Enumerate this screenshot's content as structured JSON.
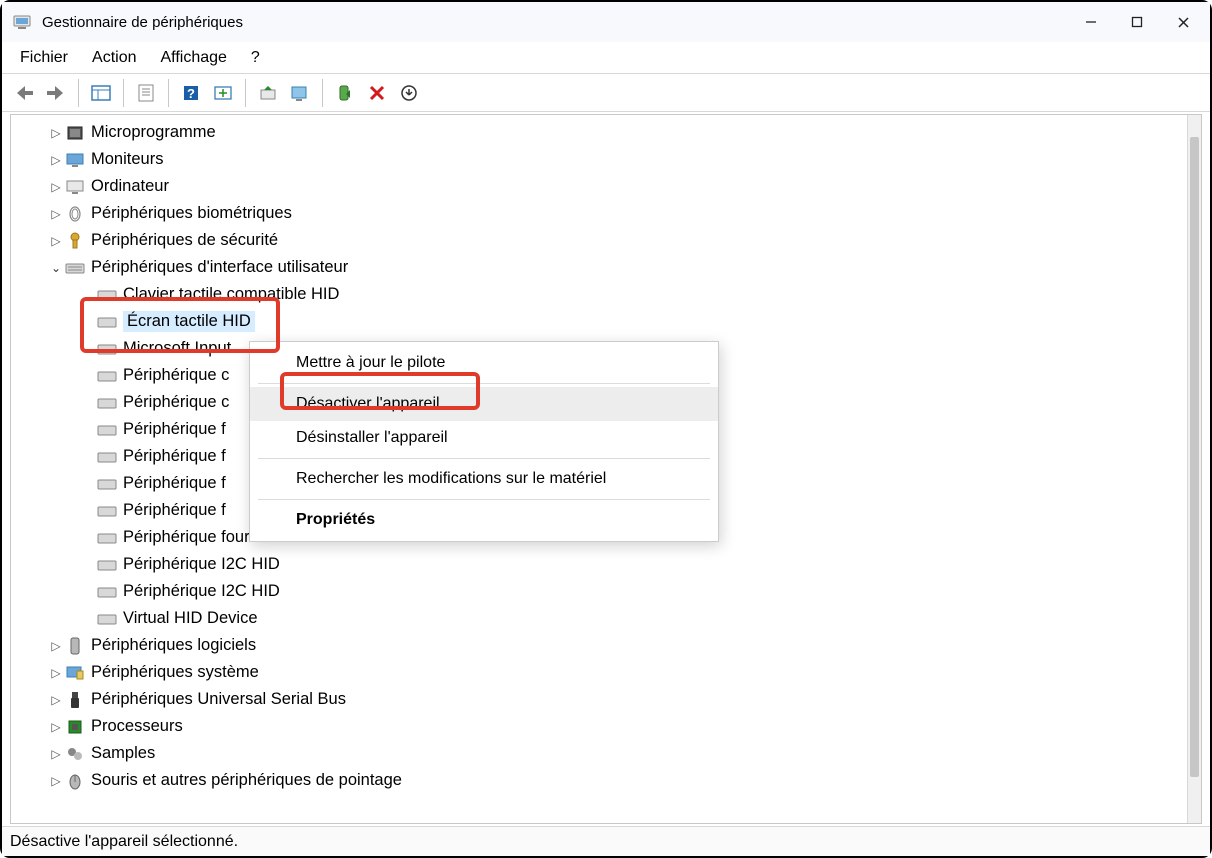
{
  "window": {
    "title": "Gestionnaire de périphériques"
  },
  "menu": {
    "file": "Fichier",
    "action": "Action",
    "view": "Affichage",
    "help": "?"
  },
  "tree": {
    "cat_firmware": "Microprogramme",
    "cat_monitors": "Moniteurs",
    "cat_computer": "Ordinateur",
    "cat_biometric": "Périphériques biométriques",
    "cat_security": "Périphériques de sécurité",
    "cat_hid": "Périphériques d'interface utilisateur",
    "hid_touch_keyboard": "Clavier tactile compatible HID",
    "hid_touch_screen": "Écran tactile HID",
    "hid_ms_input": "Microsoft Input",
    "hid_dev1": "Périphérique c",
    "hid_dev2": "Périphérique c",
    "hid_dev3": "Périphérique f",
    "hid_dev4": "Périphérique f",
    "hid_dev5": "Périphérique f",
    "hid_dev6": "Périphérique f",
    "hid_vendor": "Périphérique fournisseur HID",
    "hid_i2c1": "Périphérique I2C HID",
    "hid_i2c2": "Périphérique I2C HID",
    "hid_virtual": "Virtual HID Device",
    "cat_software": "Périphériques logiciels",
    "cat_system": "Périphériques système",
    "cat_usb": "Périphériques Universal Serial Bus",
    "cat_processors": "Processeurs",
    "cat_samples": "Samples",
    "cat_mice": "Souris et autres périphériques de pointage"
  },
  "context_menu": {
    "update": "Mettre à jour le pilote",
    "disable": "Désactiver l'appareil",
    "uninstall": "Désinstaller l'appareil",
    "scan": "Rechercher les modifications sur le matériel",
    "properties": "Propriétés"
  },
  "statusbar": {
    "text": "Désactive l'appareil sélectionné."
  }
}
